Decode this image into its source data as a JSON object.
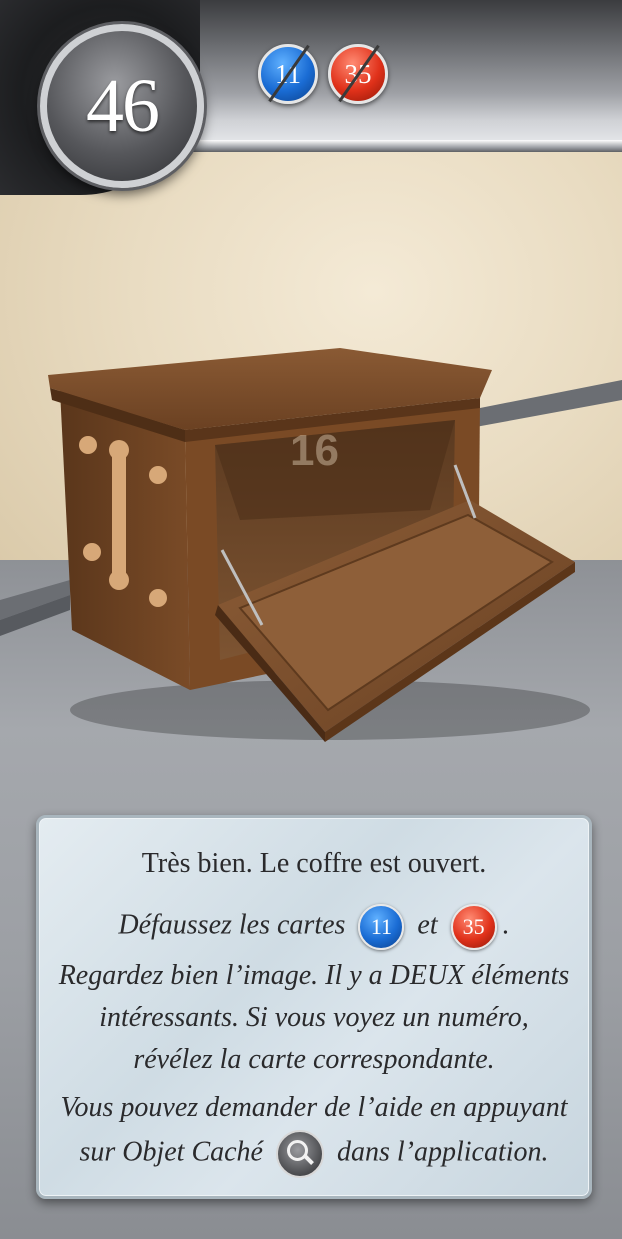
{
  "card": {
    "number": "46",
    "discarded_cards": [
      {
        "value": "11",
        "color": "#1a6cd4"
      },
      {
        "value": "35",
        "color": "#e0311a"
      }
    ]
  },
  "scene": {
    "hidden_number": "16"
  },
  "panel": {
    "line1": "Très bien. Le coffre est ouvert.",
    "discard_prefix": "Défaussez les cartes",
    "discard_card_a": "11",
    "discard_and": "et",
    "discard_card_b": "35",
    "discard_suffix": ".",
    "look_line1": "Regardez bien l’image. Il y a DEUX éléments",
    "look_line2": "intéressants. Si vous voyez un numéro,",
    "look_line3": "révélez la carte correspondante.",
    "help_line1": "Vous pouvez demander de l’aide en appuyant",
    "help_prefix": "sur Objet Caché",
    "help_icon": "magnifier-icon",
    "help_suffix": "dans l’application."
  }
}
